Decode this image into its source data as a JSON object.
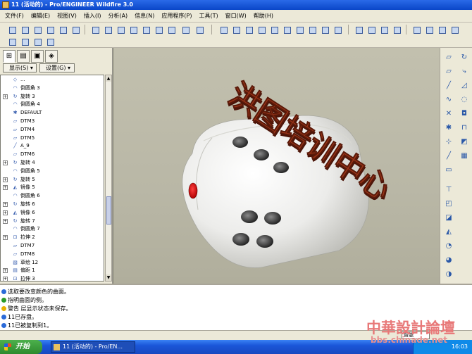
{
  "window": {
    "title": "11 (活动的) - Pro/ENGINEER Wildfire 3.0"
  },
  "menu": [
    "文件(F)",
    "编辑(E)",
    "视图(V)",
    "插入(I)",
    "分析(A)",
    "信息(N)",
    "应用程序(P)",
    "工具(T)",
    "窗口(W)",
    "帮助(H)"
  ],
  "sidebar": {
    "dropdowns": {
      "show": "显示(S) ▾",
      "settings": "设置(G) ▾"
    },
    "tree": [
      {
        "label": "...",
        "icon": "blend"
      },
      {
        "label": "倒圆角 3",
        "icon": "round"
      },
      {
        "label": "旋转 3",
        "icon": "revolve",
        "expand": "+"
      },
      {
        "label": "倒圆角 4",
        "icon": "round"
      },
      {
        "label": "DEFAULT",
        "icon": "csys"
      },
      {
        "label": "DTM3",
        "icon": "plane"
      },
      {
        "label": "DTM4",
        "icon": "plane"
      },
      {
        "label": "DTM5",
        "icon": "plane"
      },
      {
        "label": "A_9",
        "icon": "axis"
      },
      {
        "label": "DTM6",
        "icon": "plane"
      },
      {
        "label": "旋转 4",
        "icon": "revolve",
        "expand": "+"
      },
      {
        "label": "倒圆角 5",
        "icon": "round"
      },
      {
        "label": "旋转 5",
        "icon": "revolve",
        "expand": "+"
      },
      {
        "label": "镜像 5",
        "icon": "mirror",
        "expand": "+"
      },
      {
        "label": "倒圆角 6",
        "icon": "round"
      },
      {
        "label": "旋转 6",
        "icon": "revolve",
        "expand": "+"
      },
      {
        "label": "镜像 6",
        "icon": "mirror",
        "expand": "+"
      },
      {
        "label": "旋转 7",
        "icon": "revolve",
        "expand": "+"
      },
      {
        "label": "倒圆角 7",
        "icon": "round"
      },
      {
        "label": "拉伸 2",
        "icon": "extrude",
        "expand": "+"
      },
      {
        "label": "DTM7",
        "icon": "plane"
      },
      {
        "label": "DTM8",
        "icon": "plane"
      },
      {
        "label": "草绘 12",
        "icon": "sketch"
      },
      {
        "label": "偏距 1",
        "icon": "offset",
        "expand": "+"
      },
      {
        "label": "拉伸 3",
        "icon": "extrude",
        "expand": "+"
      }
    ]
  },
  "viewport": {
    "banner_text": "洪图培训中心",
    "banner_color": "#8a2a14",
    "die_color": "#f2f2ee",
    "pip_color": "#3a3a3a",
    "red_pip_color": "#e01010"
  },
  "messages": [
    {
      "icon": "info",
      "text": "选取要改变颜色的曲面。"
    },
    {
      "icon": "prompt",
      "text": "指明曲面的侧。"
    },
    {
      "icon": "warning",
      "text": "警告 层显示状态未保存。"
    },
    {
      "icon": "info",
      "text": "11已存盘。"
    },
    {
      "icon": "info",
      "text": "11已被复制到1。"
    }
  ],
  "status": {
    "filter": "智能"
  },
  "taskbar": {
    "start_label": "开始",
    "task_label": "11 (活动的) - Pro/EN...",
    "clock": "16:03"
  },
  "watermark": {
    "line1": "中華設計論壇",
    "line2": "bbs.chinade.net"
  }
}
